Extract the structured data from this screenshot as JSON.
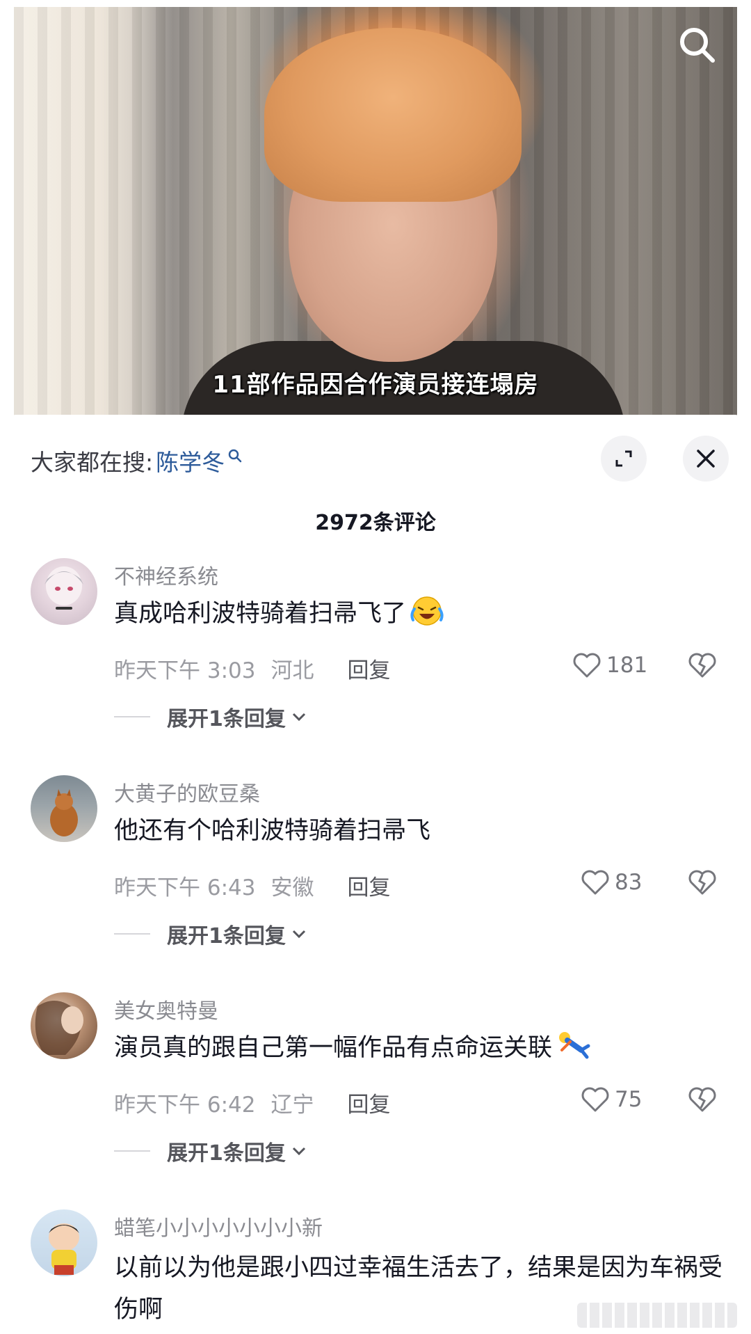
{
  "video": {
    "caption": "11部作品因合作演员接连塌房"
  },
  "sheet": {
    "search_prefix": "大家都在搜:",
    "search_keyword": "陈学冬",
    "comment_count": "2972条评论"
  },
  "comments": [
    {
      "user": "不神经系统",
      "text": "真成哈利波特骑着扫帚飞了",
      "time": "昨天下午 3:03",
      "location": "河北",
      "reply_label": "回复",
      "likes": "181",
      "expand_label": "展开1条回复",
      "emoji": "laughing-crying-emoji"
    },
    {
      "user": "大黄子的欧豆桑",
      "text": "他还有个哈利波特骑着扫帚飞",
      "time": "昨天下午 6:43",
      "location": "安徽",
      "reply_label": "回复",
      "likes": "83",
      "expand_label": "展开1条回复"
    },
    {
      "user": "美女奥特曼",
      "text": "演员真的跟自己第一幅作品有点命运关联",
      "time": "昨天下午 6:42",
      "location": "辽宁",
      "reply_label": "回复",
      "likes": "75",
      "expand_label": "展开1条回复",
      "emoji": "falling-person-emoji"
    },
    {
      "user": "蜡笔小小小小小小小新",
      "text": "以前以为他是跟小四过幸福生活去了，结果是因为车祸受伤啊"
    }
  ],
  "colors": {
    "keyword_blue": "#2d5b9a",
    "muted_text": "#9a9ba1",
    "primary_text": "#161823"
  }
}
